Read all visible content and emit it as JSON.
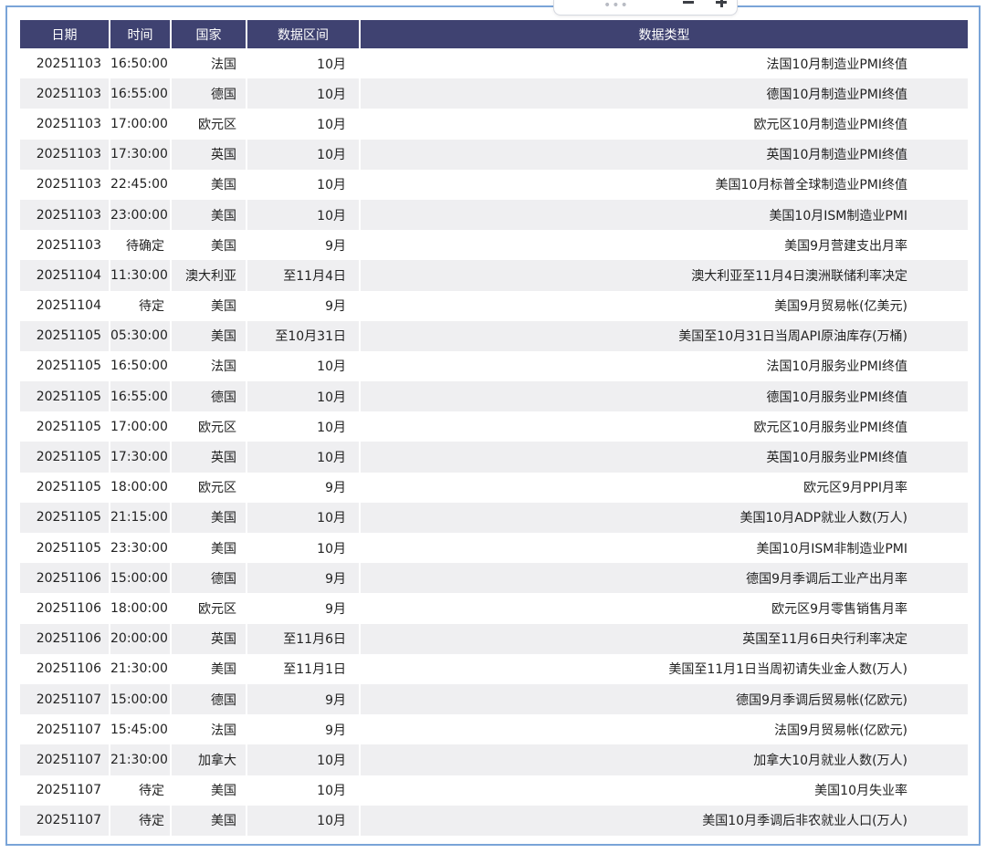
{
  "table": {
    "headers": {
      "date": "日期",
      "time": "时间",
      "country": "国家",
      "range": "数据区间",
      "type": "数据类型"
    },
    "rows": [
      {
        "date": "20251103",
        "time": "16:50:00",
        "country": "法国",
        "range": "10月",
        "type": "法国10月制造业PMI终值"
      },
      {
        "date": "20251103",
        "time": "16:55:00",
        "country": "德国",
        "range": "10月",
        "type": "德国10月制造业PMI终值"
      },
      {
        "date": "20251103",
        "time": "17:00:00",
        "country": "欧元区",
        "range": "10月",
        "type": "欧元区10月制造业PMI终值"
      },
      {
        "date": "20251103",
        "time": "17:30:00",
        "country": "英国",
        "range": "10月",
        "type": "英国10月制造业PMI终值"
      },
      {
        "date": "20251103",
        "time": "22:45:00",
        "country": "美国",
        "range": "10月",
        "type": "美国10月标普全球制造业PMI终值"
      },
      {
        "date": "20251103",
        "time": "23:00:00",
        "country": "美国",
        "range": "10月",
        "type": "美国10月ISM制造业PMI"
      },
      {
        "date": "20251103",
        "time": "待确定",
        "country": "美国",
        "range": "9月",
        "type": "美国9月营建支出月率"
      },
      {
        "date": "20251104",
        "time": "11:30:00",
        "country": "澳大利亚",
        "range": "至11月4日",
        "type": "澳大利亚至11月4日澳洲联储利率决定"
      },
      {
        "date": "20251104",
        "time": "待定",
        "country": "美国",
        "range": "9月",
        "type": "美国9月贸易帐(亿美元)"
      },
      {
        "date": "20251105",
        "time": "05:30:00",
        "country": "美国",
        "range": "至10月31日",
        "type": "美国至10月31日当周API原油库存(万桶)"
      },
      {
        "date": "20251105",
        "time": "16:50:00",
        "country": "法国",
        "range": "10月",
        "type": "法国10月服务业PMI终值"
      },
      {
        "date": "20251105",
        "time": "16:55:00",
        "country": "德国",
        "range": "10月",
        "type": "德国10月服务业PMI终值"
      },
      {
        "date": "20251105",
        "time": "17:00:00",
        "country": "欧元区",
        "range": "10月",
        "type": "欧元区10月服务业PMI终值"
      },
      {
        "date": "20251105",
        "time": "17:30:00",
        "country": "英国",
        "range": "10月",
        "type": "英国10月服务业PMI终值"
      },
      {
        "date": "20251105",
        "time": "18:00:00",
        "country": "欧元区",
        "range": "9月",
        "type": "欧元区9月PPI月率"
      },
      {
        "date": "20251105",
        "time": "21:15:00",
        "country": "美国",
        "range": "10月",
        "type": "美国10月ADP就业人数(万人)"
      },
      {
        "date": "20251105",
        "time": "23:30:00",
        "country": "美国",
        "range": "10月",
        "type": "美国10月ISM非制造业PMI"
      },
      {
        "date": "20251106",
        "time": "15:00:00",
        "country": "德国",
        "range": "9月",
        "type": "德国9月季调后工业产出月率"
      },
      {
        "date": "20251106",
        "time": "18:00:00",
        "country": "欧元区",
        "range": "9月",
        "type": "欧元区9月零售销售月率"
      },
      {
        "date": "20251106",
        "time": "20:00:00",
        "country": "英国",
        "range": "至11月6日",
        "type": "英国至11月6日央行利率决定"
      },
      {
        "date": "20251106",
        "time": "21:30:00",
        "country": "美国",
        "range": "至11月1日",
        "type": "美国至11月1日当周初请失业金人数(万人)"
      },
      {
        "date": "20251107",
        "time": "15:00:00",
        "country": "德国",
        "range": "9月",
        "type": "德国9月季调后贸易帐(亿欧元)"
      },
      {
        "date": "20251107",
        "time": "15:45:00",
        "country": "法国",
        "range": "9月",
        "type": "法国9月贸易帐(亿欧元)"
      },
      {
        "date": "20251107",
        "time": "21:30:00",
        "country": "加拿大",
        "range": "10月",
        "type": "加拿大10月就业人数(万人)"
      },
      {
        "date": "20251107",
        "time": "待定",
        "country": "美国",
        "range": "10月",
        "type": "美国10月失业率"
      },
      {
        "date": "20251107",
        "time": "待定",
        "country": "美国",
        "range": "10月",
        "type": "美国10月季调后非农就业人口(万人)"
      }
    ]
  },
  "toolbar": {
    "dots_icon": "more-dots-icon",
    "zoom_out_icon": "zoom-out-icon",
    "zoom_in_icon": "zoom-in-icon",
    "dots_glyph": "•••"
  },
  "colors": {
    "header_bg": "#3f4271",
    "header_text": "#ffffff",
    "row_alt": "#efeff1",
    "frame_border": "#7aa4d8"
  }
}
